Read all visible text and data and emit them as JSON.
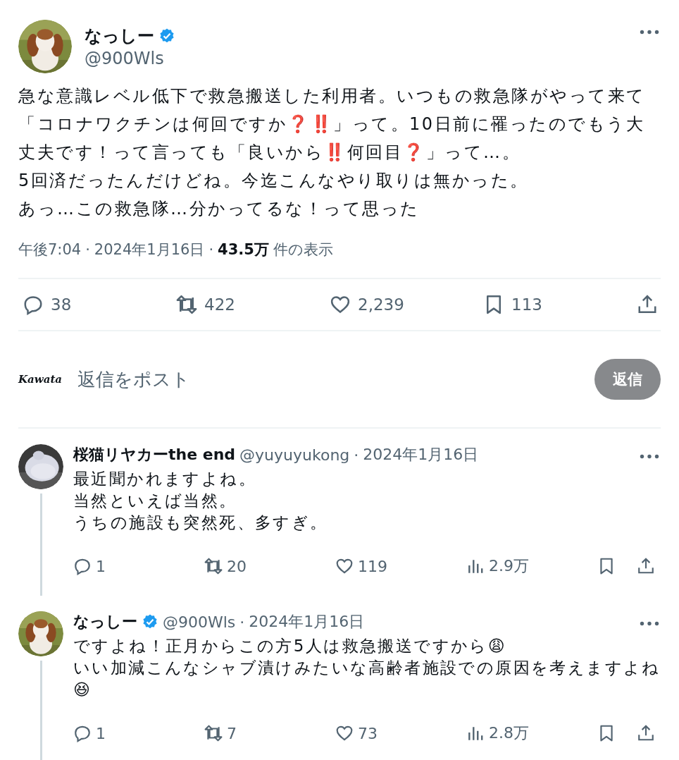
{
  "post": {
    "author": {
      "name": "なっしー",
      "verified": true,
      "handle": "@900Wls"
    },
    "body_lines": [
      "急な意識レベル低下で救急搬送した利用者。いつもの救急隊がやって来て「コロナワクチンは何回ですか❓‼️」って。10日前に罹ったのでもう大丈夫です！って言っても「良いから‼️何回目❓」って…。",
      "5回済だったんだけどね。今迄こんなやり取りは無かった。",
      "あっ…この救急隊…分かってるな！って思った"
    ],
    "meta": {
      "separator": "·",
      "time": "午後7:04",
      "date": "2024年1月16日",
      "views": "43.5万",
      "views_label": "件の表示"
    },
    "actions": [
      {
        "kind": "reply",
        "count": "38"
      },
      {
        "kind": "repost",
        "count": "422"
      },
      {
        "kind": "like",
        "count": "2,239"
      },
      {
        "kind": "bookmark",
        "count": "113"
      },
      {
        "kind": "share"
      }
    ]
  },
  "composer": {
    "avatar_logo": "Kawata",
    "placeholder": "返信をポスト",
    "button": "返信",
    "disabled": true
  },
  "replies": [
    {
      "name": "桜猫リヤカーthe end",
      "handle": "@yuyuyukong",
      "separator": "·",
      "date": "2024年1月16日",
      "thread_line": true,
      "lines": [
        "最近聞かれますよね。",
        "当然といえば当然。",
        "うちの施設も突然死、多すぎ。"
      ],
      "actions": [
        {
          "kind": "reply",
          "count": "1"
        },
        {
          "kind": "repost",
          "count": "20"
        },
        {
          "kind": "like",
          "count": "119"
        },
        {
          "kind": "views",
          "count": "2.9万"
        },
        {
          "kind": "bookmark"
        },
        {
          "kind": "share"
        }
      ]
    },
    {
      "name": "なっしー",
      "verified": true,
      "handle": "@900Wls",
      "separator": "·",
      "date": "2024年1月16日",
      "thread_line": true,
      "lines": [
        "ですよね！正月からこの方5人は救急搬送ですから😩",
        "いい加減こんなシャブ漬けみたいな高齢者施設での原因を考えますよね😆"
      ],
      "actions": [
        {
          "kind": "reply",
          "count": "1"
        },
        {
          "kind": "repost",
          "count": "7"
        },
        {
          "kind": "like",
          "count": "73"
        },
        {
          "kind": "views",
          "count": "2.8万"
        },
        {
          "kind": "bookmark"
        },
        {
          "kind": "share"
        }
      ]
    }
  ]
}
